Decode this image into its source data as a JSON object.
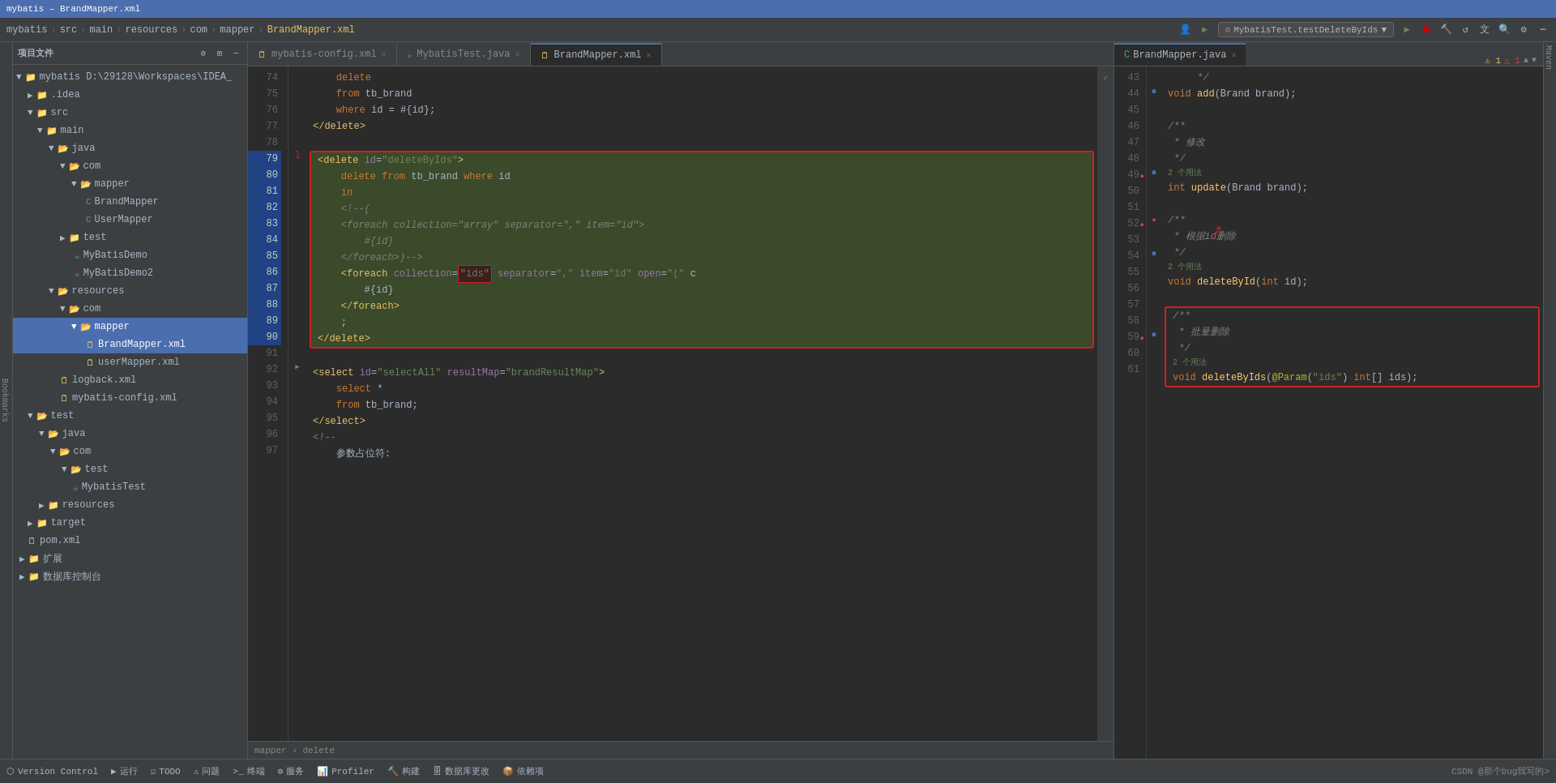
{
  "window": {
    "title": "mybatis – BrandMapper.xml",
    "breadcrumb": [
      "mybatis",
      "src",
      "main",
      "resources",
      "com",
      "mapper",
      "BrandMapper.xml"
    ]
  },
  "toolbar": {
    "run_config": "MybatisTest.testDeleteByIds",
    "buttons": [
      "run",
      "debug",
      "coverage",
      "profile",
      "build",
      "search",
      "settings"
    ]
  },
  "sidebar": {
    "title": "项目文件",
    "tree": [
      {
        "id": "mybatis",
        "label": "mybatis D:\\29128\\Workspaces\\IDEA_",
        "level": 0,
        "type": "folder",
        "expanded": true
      },
      {
        "id": "idea",
        "label": ".idea",
        "level": 1,
        "type": "folder",
        "expanded": false
      },
      {
        "id": "src",
        "label": "src",
        "level": 1,
        "type": "folder",
        "expanded": true
      },
      {
        "id": "main",
        "label": "main",
        "level": 2,
        "type": "folder",
        "expanded": true
      },
      {
        "id": "java",
        "label": "java",
        "level": 3,
        "type": "folder",
        "expanded": true
      },
      {
        "id": "com",
        "label": "com",
        "level": 4,
        "type": "folder",
        "expanded": true
      },
      {
        "id": "mapper",
        "label": "mapper",
        "level": 5,
        "type": "folder",
        "expanded": true
      },
      {
        "id": "brandmapper",
        "label": "BrandMapper",
        "level": 6,
        "type": "java"
      },
      {
        "id": "usermapper",
        "label": "UserMapper",
        "level": 6,
        "type": "java"
      },
      {
        "id": "test_folder",
        "label": "test",
        "level": 4,
        "type": "folder",
        "expanded": true
      },
      {
        "id": "mybatisdemo",
        "label": "MyBatisDemo",
        "level": 5,
        "type": "java"
      },
      {
        "id": "mybatisdemo2",
        "label": "MyBatisDemo2",
        "level": 5,
        "type": "java"
      },
      {
        "id": "resources",
        "label": "resources",
        "level": 2,
        "type": "folder",
        "expanded": true
      },
      {
        "id": "res_com",
        "label": "com",
        "level": 3,
        "type": "folder",
        "expanded": true
      },
      {
        "id": "res_mapper",
        "label": "mapper",
        "level": 4,
        "type": "folder",
        "expanded": true,
        "selected": true
      },
      {
        "id": "brandmapper_xml",
        "label": "BrandMapper.xml",
        "level": 5,
        "type": "xml",
        "selected": true
      },
      {
        "id": "usermapper_xml",
        "label": "userMapper.xml",
        "level": 5,
        "type": "xml"
      },
      {
        "id": "logback",
        "label": "logback.xml",
        "level": 3,
        "type": "xml"
      },
      {
        "id": "mybatis_config",
        "label": "mybatis-config.xml",
        "level": 3,
        "type": "xml"
      },
      {
        "id": "test_java",
        "label": "test",
        "level": 1,
        "type": "folder",
        "expanded": true
      },
      {
        "id": "test_java2",
        "label": "java",
        "level": 2,
        "type": "folder",
        "expanded": true
      },
      {
        "id": "test_com",
        "label": "com",
        "level": 3,
        "type": "folder",
        "expanded": true
      },
      {
        "id": "test_test",
        "label": "test",
        "level": 4,
        "type": "folder",
        "expanded": true
      },
      {
        "id": "mybatistest",
        "label": "MybatisTest",
        "level": 5,
        "type": "java"
      },
      {
        "id": "test_resources",
        "label": "resources",
        "level": 2,
        "type": "folder"
      },
      {
        "id": "target",
        "label": "target",
        "level": 1,
        "type": "folder"
      },
      {
        "id": "extend",
        "label": "扩展",
        "level": 1,
        "type": "folder"
      },
      {
        "id": "db_console",
        "label": "数据库控制台",
        "level": 1,
        "type": "folder"
      }
    ]
  },
  "editor": {
    "tabs": [
      {
        "label": "mybatis-config.xml",
        "active": false,
        "closeable": true
      },
      {
        "label": "MybatisTest.java",
        "active": false,
        "closeable": true
      },
      {
        "label": "BrandMapper.xml",
        "active": true,
        "closeable": true
      }
    ],
    "lines": [
      {
        "num": 74,
        "content": "    delete",
        "highlighted": false
      },
      {
        "num": 75,
        "content": "    from tb_brand",
        "highlighted": false
      },
      {
        "num": 76,
        "content": "    where id = #{id};",
        "highlighted": false
      },
      {
        "num": 77,
        "content": "</delete>",
        "highlighted": false
      },
      {
        "num": 78,
        "content": "",
        "highlighted": false
      },
      {
        "num": 79,
        "content": "<delete id=\"deleteByIds\">",
        "highlighted": true,
        "block_start": true
      },
      {
        "num": 80,
        "content": "    delete from tb_brand where id",
        "highlighted": true
      },
      {
        "num": 81,
        "content": "    in",
        "highlighted": true
      },
      {
        "num": 82,
        "content": "    <!--(",
        "highlighted": true
      },
      {
        "num": 83,
        "content": "    <foreach collection=\"array\" separator=\",\" item=\"id\">",
        "highlighted": true
      },
      {
        "num": 84,
        "content": "        #{id}",
        "highlighted": true
      },
      {
        "num": 85,
        "content": "    </foreach>)-->",
        "highlighted": true
      },
      {
        "num": 86,
        "content": "    <foreach collection=\"ids\" separator=\",\" item=\"id\" open=\"(\" c",
        "highlighted": true
      },
      {
        "num": 87,
        "content": "        #{id}",
        "highlighted": true
      },
      {
        "num": 88,
        "content": "    </foreach>",
        "highlighted": true
      },
      {
        "num": 89,
        "content": "    ;",
        "highlighted": true
      },
      {
        "num": 90,
        "content": "</delete>",
        "highlighted": true,
        "block_end": true
      },
      {
        "num": 91,
        "content": "",
        "highlighted": false
      },
      {
        "num": 92,
        "content": "<select id=\"selectAll\" resultMap=\"brandResultMap\">",
        "highlighted": false
      },
      {
        "num": 93,
        "content": "    select *",
        "highlighted": false
      },
      {
        "num": 94,
        "content": "    from tb_brand;",
        "highlighted": false
      },
      {
        "num": 95,
        "content": "</select>",
        "highlighted": false
      },
      {
        "num": 96,
        "content": "<!--",
        "highlighted": false
      },
      {
        "num": 97,
        "content": "    参数占位符:",
        "highlighted": false
      }
    ]
  },
  "right_panel": {
    "tab": "BrandMapper.java",
    "lines": [
      {
        "num": 43,
        "content": "    */"
      },
      {
        "num": 44,
        "content": "void add(Brand brand);",
        "type": "method"
      },
      {
        "num": 45,
        "content": ""
      },
      {
        "num": 46,
        "content": "/**"
      },
      {
        "num": 47,
        "content": " * 修改"
      },
      {
        "num": 48,
        "content": " */"
      },
      {
        "num": 49,
        "content": "int update(Brand brand);",
        "type": "method",
        "usage": "2 个用法"
      },
      {
        "num": 50,
        "content": ""
      },
      {
        "num": 51,
        "content": "/**"
      },
      {
        "num": 52,
        "content": " * 根据id删除",
        "has_arrow": true
      },
      {
        "num": 53,
        "content": " */"
      },
      {
        "num": 54,
        "content": "void deleteById(int id);",
        "type": "method",
        "usage": "2 个用法"
      },
      {
        "num": 55,
        "content": ""
      },
      {
        "num": 56,
        "content": "/**",
        "box_start": true
      },
      {
        "num": 57,
        "content": " * 批量删除"
      },
      {
        "num": 58,
        "content": " */"
      },
      {
        "num": 59,
        "content": "void deleteByIds(@Param(\"ids\") int[] ids);",
        "box_end": true,
        "type": "method",
        "usage": "2 个用法"
      },
      {
        "num": 60,
        "content": ""
      },
      {
        "num": 61,
        "content": ""
      }
    ]
  },
  "bottom_bar": {
    "items": [
      "Version Control",
      "运行",
      "TODO",
      "问题",
      "终端",
      "服务",
      "Profiler",
      "构建",
      "数据库更改",
      "依赖项"
    ],
    "breadcrumb": "mapper › delete",
    "watermark": "CSDN @那个bug我写的>"
  }
}
